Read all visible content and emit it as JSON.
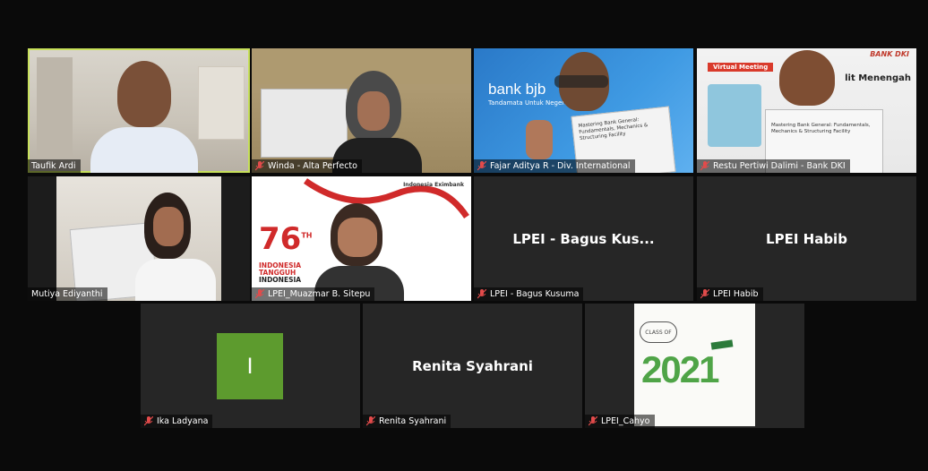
{
  "participants": [
    {
      "name": "Taufik Ardi",
      "muted": false,
      "active": true
    },
    {
      "name": "Winda - Alta Perfecto",
      "muted": true
    },
    {
      "name": "Fajar Aditya R - Div. International",
      "muted": true
    },
    {
      "name": "Restu Pertiwi Dalimi - Bank DKI",
      "muted": true
    },
    {
      "name": "Mutiya Ediyanthi",
      "muted": false
    },
    {
      "name": "LPEI_Muazmar B. Sitepu",
      "muted": true
    },
    {
      "name": "LPEI - Bagus Kusuma",
      "muted": true,
      "display": "LPEI - Bagus Kus..."
    },
    {
      "name": "LPEI Habib",
      "muted": true,
      "display": "LPEI Habib"
    },
    {
      "name": "Ika Ladyana",
      "muted": true,
      "initial": "I"
    },
    {
      "name": "Renita Syahrani",
      "muted": true,
      "display": "Renita Syahrani"
    },
    {
      "name": "LPEI_Cahyo",
      "muted": true
    }
  ],
  "video_text": {
    "bjb_brand": "bank bjb",
    "bjb_tagline": "Tandamata Untuk Negeri",
    "bjb_book": "Mastering Bank General: Fundamentals, Mechanics & Structuring Facility",
    "dki_banner": "Virtual Meeting",
    "dki_logo": "BANK DKI",
    "dki_heading": "lit Menengah",
    "dki_book": "Mastering Bank General: Fundamentals, Mechanics & Structuring Facility",
    "idn_76": "76",
    "idn_th": "TH",
    "idn_line1": "INDONESIA",
    "idn_line2": "TANGGUH",
    "idn_line3": "INDONESIA",
    "idn_logo": "Indonesia Eximbank",
    "class_of": "CLASS OF",
    "class_year": "2021"
  },
  "colors": {
    "active_border": "#c7e05a",
    "muted_icon": "#e24b4b",
    "tile_bg": "#262626"
  }
}
